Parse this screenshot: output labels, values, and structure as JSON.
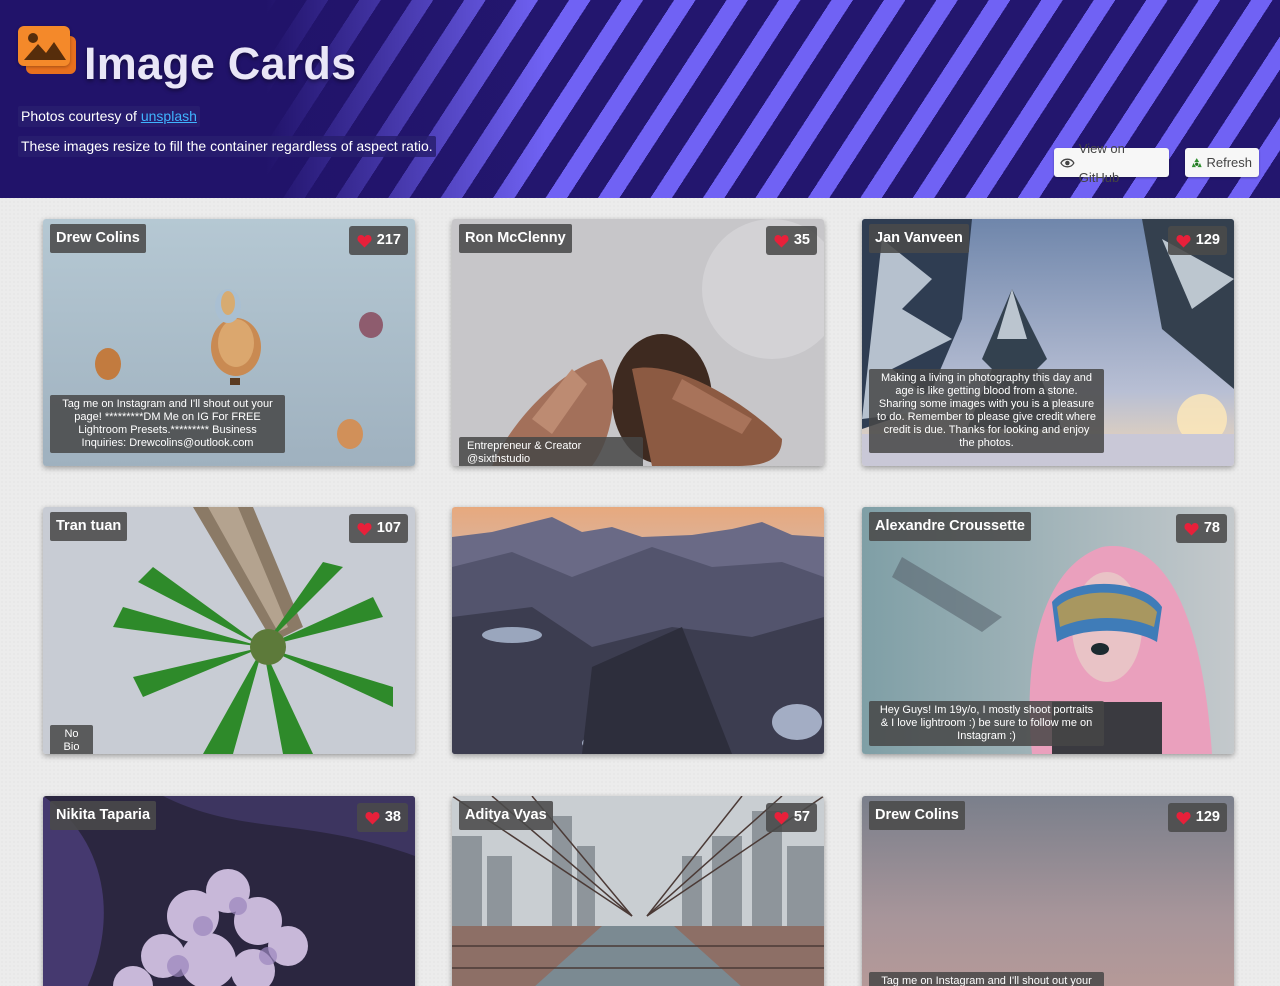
{
  "header": {
    "title": "Image Cards",
    "credit_prefix": "Photos courtesy of ",
    "credit_link": "unsplash",
    "subtitle": "These images resize to fill the container regardless of aspect ratio.",
    "github_button": "View on GitHub",
    "refresh_button": "Refresh",
    "accent_color": "#7062f4",
    "stripe_dark": "#23166e"
  },
  "cards": [
    {
      "name": "Drew Colins",
      "likes": "217",
      "bio": "Tag me on Instagram and I'll shout out your page! *********DM Me on IG For FREE Lightroom Presets.********* Business Inquiries: Drewcolins@outlook.com",
      "photo": "hot-air-balloons"
    },
    {
      "name": "Ron McClenny",
      "likes": "35",
      "bio": "Entrepreneur & Creator @sixthstudio",
      "photo": "hands"
    },
    {
      "name": "Jan Vanveen",
      "likes": "129",
      "bio": "Making a living in photography this day and age is like getting blood from a stone. Sharing some images with you is a pleasure to do. Remember to please give credit where credit is due. Thanks for looking and enjoy the photos.",
      "photo": "snowy-pines"
    },
    {
      "name": "Tran tuan",
      "likes": "107",
      "bio": "No Bio",
      "photo": "palm-tree"
    },
    {
      "name": "",
      "likes": "",
      "bio": "",
      "photo": "mountains"
    },
    {
      "name": "Alexandre Croussette",
      "likes": "78",
      "bio": "Hey Guys! Im 19y/o, I mostly shoot portraits & I love lightroom :) be sure to follow me on Instagram :)",
      "photo": "pink-hair-visor"
    },
    {
      "name": "Nikita Taparia",
      "likes": "38",
      "bio": "",
      "photo": "flowers"
    },
    {
      "name": "Aditya Vyas",
      "likes": "57",
      "bio": "",
      "photo": "bridge"
    },
    {
      "name": "Drew Colins",
      "likes": "129",
      "bio": "Tag me on Instagram and I'll shout out your",
      "photo": "gradient-sky"
    }
  ]
}
